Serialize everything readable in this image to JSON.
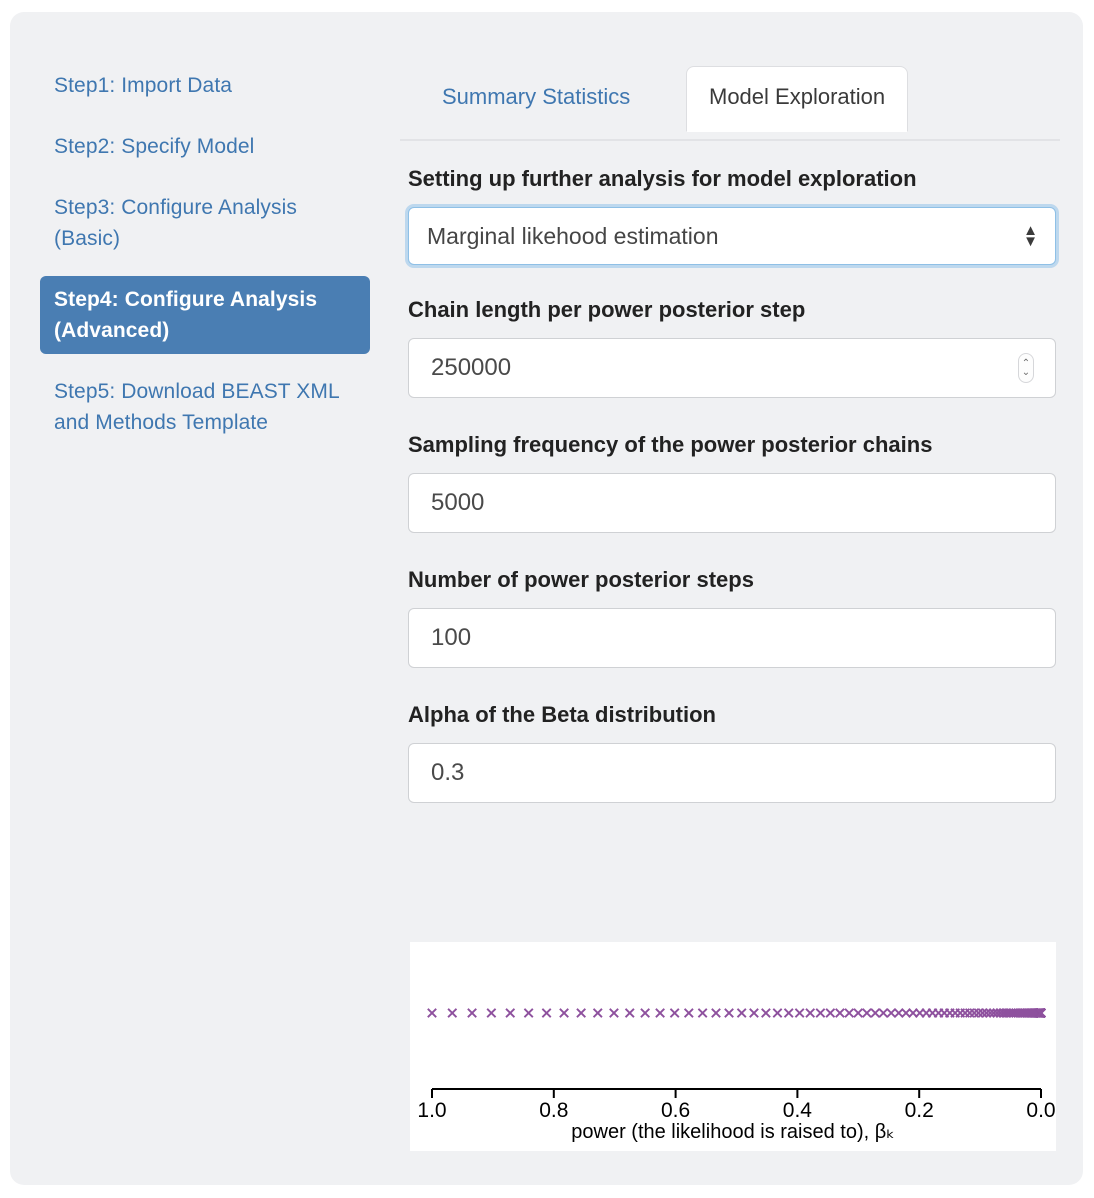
{
  "sidebar": {
    "items": [
      {
        "label": "Step1: Import Data",
        "active": false
      },
      {
        "label": "Step2: Specify Model",
        "active": false
      },
      {
        "label": "Step3: Configure Analysis (Basic)",
        "active": false
      },
      {
        "label": "Step4: Configure Analysis (Advanced)",
        "active": true
      },
      {
        "label": "Step5: Download BEAST XML and Methods Template",
        "active": false
      }
    ]
  },
  "tabs": [
    {
      "label": "Summary Statistics",
      "active": false
    },
    {
      "label": "Model Exploration",
      "active": true
    }
  ],
  "main": {
    "heading": "Setting up further analysis for model exploration",
    "analysis_select": {
      "label": "",
      "value": "Marginal likehood estimation",
      "options": [
        "Marginal likehood estimation"
      ],
      "arrow_up_icon": "▲",
      "arrow_down_icon": "▼"
    },
    "fields": [
      {
        "label": "Chain length per power posterior step",
        "value": "250000",
        "placeholder": "",
        "spinner": true,
        "spinner_up_icon": "⌃",
        "spinner_down_icon": "⌄"
      },
      {
        "label": "Sampling frequency of the power posterior chains",
        "value": "5000",
        "placeholder": "",
        "spinner": false
      },
      {
        "label": "Number of power posterior steps",
        "value": "100",
        "placeholder": "",
        "spinner": false
      },
      {
        "label": "Alpha of the Beta distribution",
        "value": "0.3",
        "placeholder": "",
        "spinner": false
      }
    ]
  },
  "colors": {
    "panel_bg": "#f0f1f3",
    "link_blue": "#3f77b0",
    "active_blue": "#4a7eb3",
    "marker_purple": "#8e519e",
    "axis_black": "#000000",
    "input_border": "#cfd1d4",
    "focus_ring": "#8fc0e6"
  },
  "chart_data": {
    "type": "scatter",
    "title": "",
    "xlabel": "power (the likelihood is raised to), βₖ",
    "ylabel": "",
    "xlim": [
      1.0,
      0.0
    ],
    "x_axis_reversed": true,
    "xticks": [
      1.0,
      0.8,
      0.6,
      0.4,
      0.2,
      0.0
    ],
    "xtick_labels": [
      "1.0",
      "0.8",
      "0.6",
      "0.4",
      "0.2",
      "0.0"
    ],
    "grid": false,
    "legend": false,
    "marker": "x",
    "marker_color": "#8e519e",
    "n_points": 100,
    "description": "Beta(0.3, 1) quantiles for 100 power posterior steps; betas = ((k)/(n-1))^(1/alpha) for k = n-1 ... 0, alpha = 0.3",
    "series": [
      {
        "name": "power posterior betas",
        "x": [
          1.0,
          0.96996,
          0.94013,
          0.91051,
          0.88112,
          0.85196,
          0.82305,
          0.79438,
          0.76597,
          0.73783,
          0.70996,
          0.68238,
          0.65509,
          0.6281,
          0.60142,
          0.57506,
          0.54903,
          0.52334,
          0.498,
          0.47302,
          0.44841,
          0.42418,
          0.40035,
          0.37692,
          0.35391,
          0.33133,
          0.30919,
          0.2875,
          0.26628,
          0.24555,
          0.22531,
          0.20558,
          0.18638,
          0.16772,
          0.14962,
          0.13209,
          0.11516,
          0.09884,
          0.08316,
          0.06813,
          0.05378,
          0.04014,
          0.02722,
          0.01506,
          0.00369,
          0.0925,
          0.0868,
          0.0813,
          0.076,
          0.0709,
          0.066,
          0.0613,
          0.0568,
          0.0525,
          0.0484,
          0.0445,
          0.0408,
          0.0373,
          0.034,
          0.0309,
          0.028,
          0.0253,
          0.0228,
          0.0205,
          0.0183,
          0.0163,
          0.0145,
          0.0128,
          0.0113,
          0.0099,
          0.0086,
          0.0075,
          0.0065,
          0.0055,
          0.0047,
          0.004,
          0.0033,
          0.0027,
          0.0022,
          0.0018,
          0.0014,
          0.0011,
          0.00085,
          0.00062,
          0.00045,
          0.00031,
          0.00021,
          0.00013,
          7e-05,
          3e-05,
          1e-05,
          0.0,
          0.0,
          0.0,
          0.0,
          0.0,
          0.0,
          0.0,
          0.0,
          0.0
        ],
        "y_constant": 0
      }
    ]
  }
}
